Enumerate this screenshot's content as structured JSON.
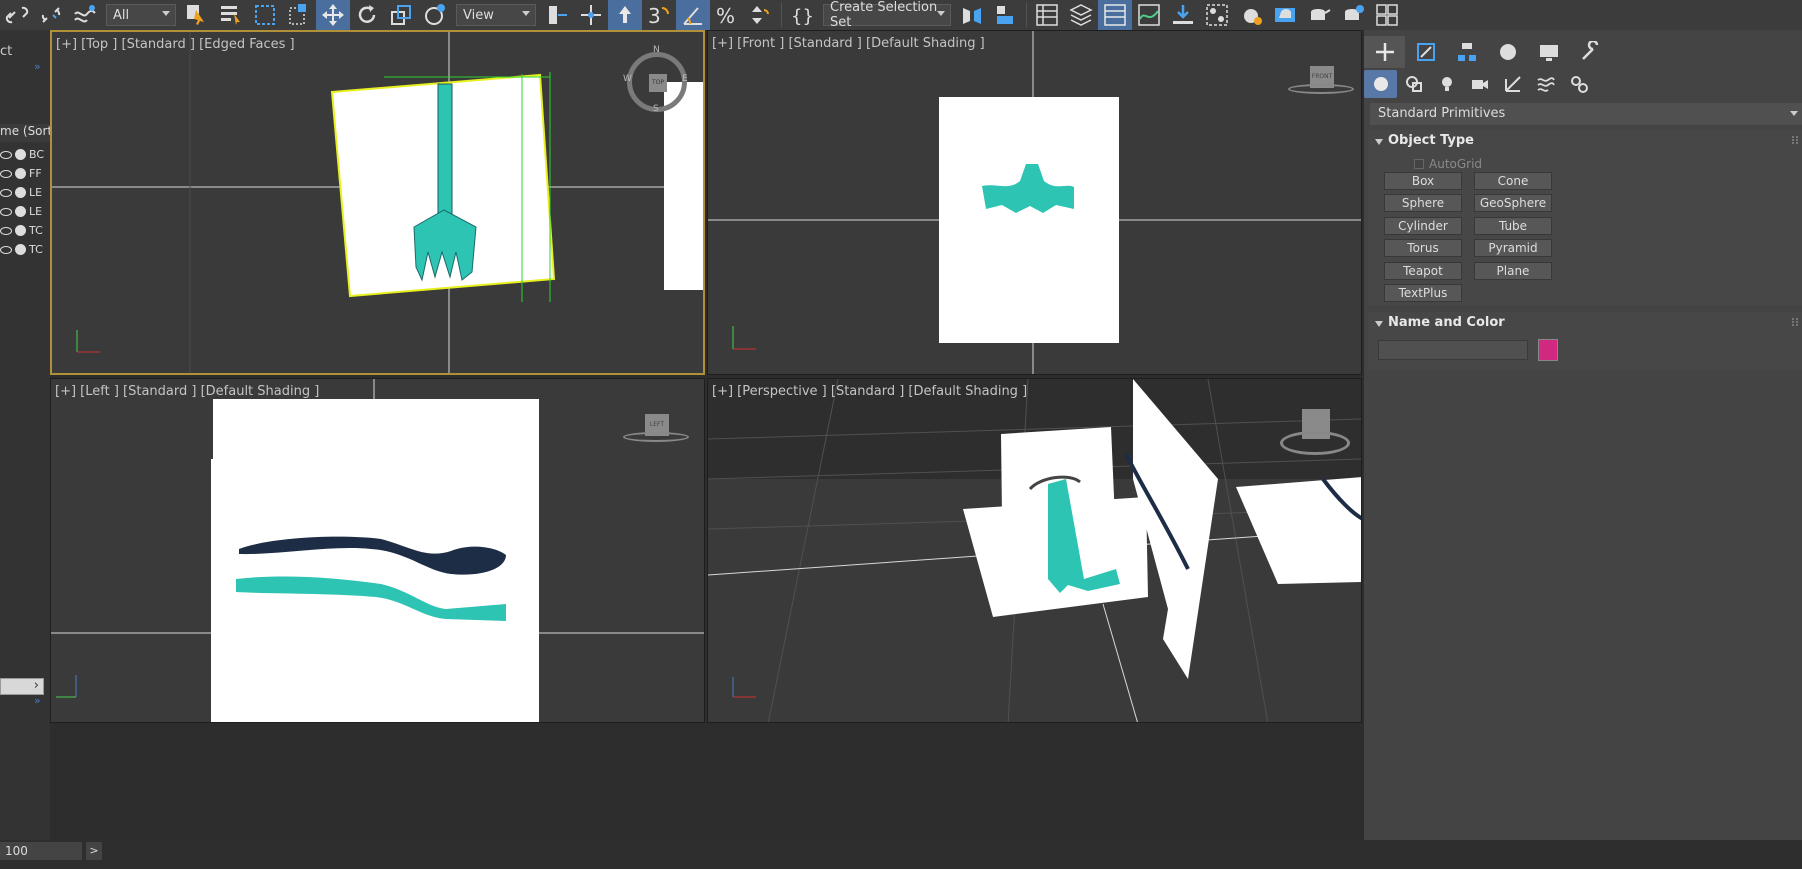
{
  "toolbar": {
    "selection_filter": "All",
    "ref_coord": "View",
    "selection_set": "Create Selection Set"
  },
  "explorer": {
    "header": "ct",
    "column_header": "me (Sorte",
    "items": [
      "BC",
      "FF",
      "LE",
      "LE",
      "TC",
      "TC"
    ],
    "frame_value": "100"
  },
  "viewports": {
    "top": {
      "label": "[+] [Top ] [Standard ] [Edged Faces ]",
      "cube": "TOP"
    },
    "front": {
      "label": "[+] [Front ] [Standard ] [Default Shading ]",
      "cube": "FRONT"
    },
    "left": {
      "label": "[+] [Left ] [Standard ] [Default Shading ]",
      "cube": "LEFT"
    },
    "perspective": {
      "label": "[+] [Perspective ] [Standard ] [Default Shading ]"
    }
  },
  "compass": {
    "n": "N",
    "s": "S",
    "e": "E",
    "w": "W"
  },
  "command_panel": {
    "category": "Standard Primitives",
    "object_type": {
      "title": "Object Type",
      "autogrid": "AutoGrid",
      "buttons": [
        "Box",
        "Cone",
        "Sphere",
        "GeoSphere",
        "Cylinder",
        "Tube",
        "Torus",
        "Pyramid",
        "Teapot",
        "Plane",
        "TextPlus"
      ]
    },
    "name_color": {
      "title": "Name and Color",
      "color": "#d1297f"
    }
  },
  "colors": {
    "accent": "#4a6e9e",
    "active_viewport": "#b0913a",
    "teal": "#2ec4b4"
  }
}
